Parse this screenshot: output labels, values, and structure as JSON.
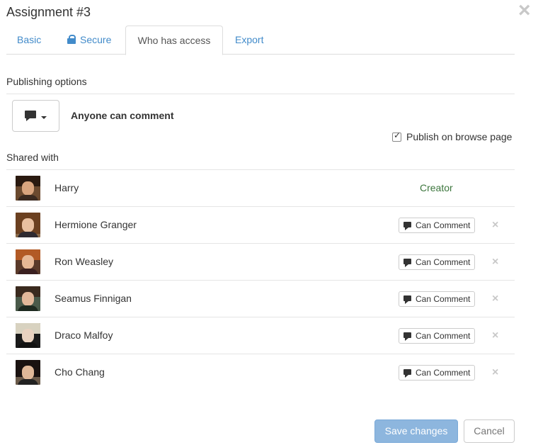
{
  "dialog": {
    "title": "Assignment #3"
  },
  "tabs": [
    {
      "label": "Basic",
      "active": false
    },
    {
      "label": "Secure",
      "active": false,
      "icon": "lock-icon"
    },
    {
      "label": "Who has access",
      "active": true
    },
    {
      "label": "Export",
      "active": false
    }
  ],
  "publishing": {
    "section_label": "Publishing options",
    "selected_option": "Anyone can comment",
    "selected_icon": "comment-icon",
    "publish_checkbox_label": "Publish on browse page",
    "publish_checked": true
  },
  "shared": {
    "section_label": "Shared with",
    "people": [
      {
        "name": "Harry",
        "role": "Creator",
        "removable": false
      },
      {
        "name": "Hermione Granger",
        "permission": "Can Comment",
        "removable": true
      },
      {
        "name": "Ron Weasley",
        "permission": "Can Comment",
        "removable": true
      },
      {
        "name": "Seamus Finnigan",
        "permission": "Can Comment",
        "removable": true
      },
      {
        "name": "Draco Malfoy",
        "permission": "Can Comment",
        "removable": true
      },
      {
        "name": "Cho Chang",
        "permission": "Can Comment",
        "removable": true
      }
    ]
  },
  "footer": {
    "save_label": "Save changes",
    "cancel_label": "Cancel"
  },
  "colors": {
    "link": "#428bca",
    "creator": "#3c763d",
    "save_button": "#8db6de"
  }
}
